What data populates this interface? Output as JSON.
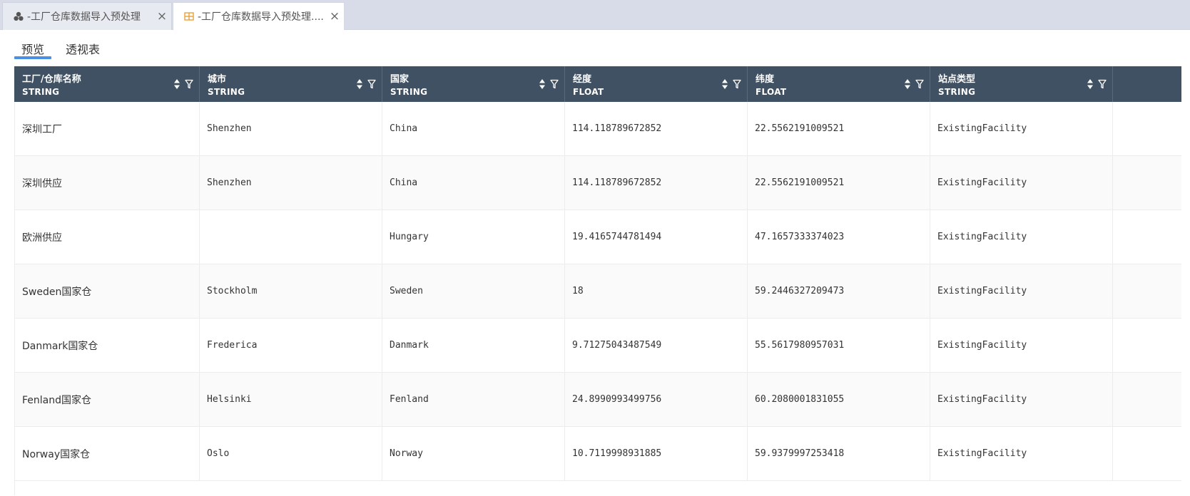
{
  "tabs": [
    {
      "label": "-工厂仓库数据导入预处理",
      "icon": "dataset-icon",
      "close": "×"
    },
    {
      "label": "-工厂仓库数据导入预处理....",
      "icon": "table-icon",
      "close": "×"
    }
  ],
  "view_tabs": [
    {
      "label": "预览",
      "active": true
    },
    {
      "label": "透视表",
      "active": false
    }
  ],
  "accent_color": "#4a90e2",
  "header_color": "#3f5163",
  "table": {
    "columns": [
      {
        "name": "工厂/仓库名称",
        "type": "STRING"
      },
      {
        "name": "城市",
        "type": "STRING"
      },
      {
        "name": "国家",
        "type": "STRING"
      },
      {
        "name": "经度",
        "type": "FLOAT"
      },
      {
        "name": "纬度",
        "type": "FLOAT"
      },
      {
        "name": "站点类型",
        "type": "STRING"
      }
    ],
    "rows": [
      [
        "深圳工厂",
        "Shenzhen",
        "China",
        "114.118789672852",
        "22.5562191009521",
        "ExistingFacility"
      ],
      [
        "深圳供应",
        "Shenzhen",
        "China",
        "114.118789672852",
        "22.5562191009521",
        "ExistingFacility"
      ],
      [
        "欧洲供应",
        "",
        "Hungary",
        "19.4165744781494",
        "47.1657333374023",
        "ExistingFacility"
      ],
      [
        "Sweden国家仓",
        "Stockholm",
        "Sweden",
        "18",
        "59.2446327209473",
        "ExistingFacility"
      ],
      [
        "Danmark国家仓",
        "Frederica",
        "Danmark",
        "9.71275043487549",
        "55.5617980957031",
        "ExistingFacility"
      ],
      [
        "Fenland国家仓",
        "Helsinki",
        "Fenland",
        "24.8990993499756",
        "60.2080001831055",
        "ExistingFacility"
      ],
      [
        "Norway国家仓",
        "Oslo",
        "Norway",
        "10.7119998931885",
        "59.9379997253418",
        "ExistingFacility"
      ]
    ]
  }
}
